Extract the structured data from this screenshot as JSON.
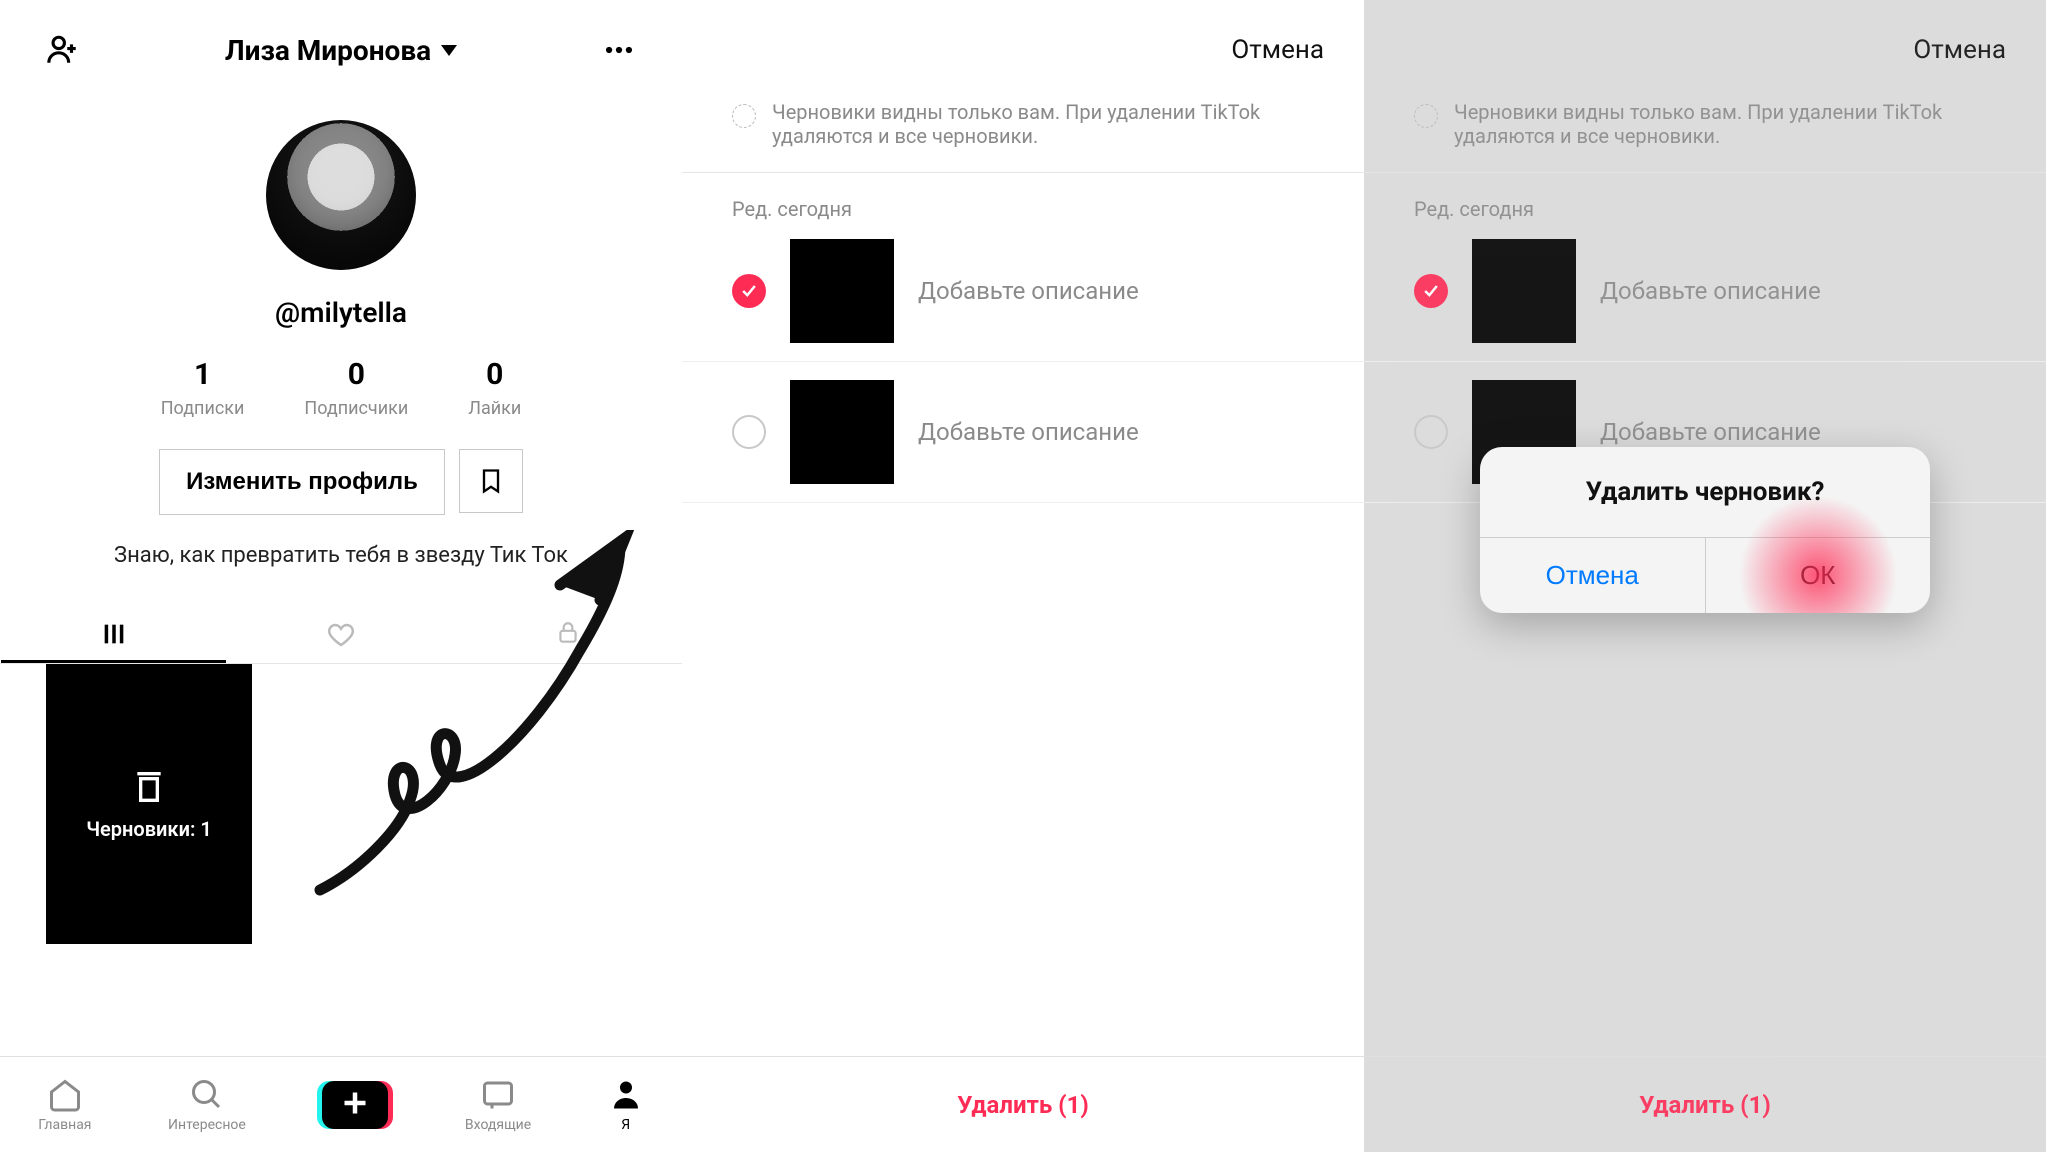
{
  "profile": {
    "display_name": "Лиза Миронова",
    "handle": "@milytella",
    "bio": "Знаю, как превратить тебя в звезду Тик Ток",
    "stats": {
      "subscriptions": {
        "n": "1",
        "label": "Подписки"
      },
      "followers": {
        "n": "0",
        "label": "Подписчики"
      },
      "likes": {
        "n": "0",
        "label": "Лайки"
      }
    },
    "edit_btn": "Изменить профиль",
    "draft_tile": "Черновики: 1"
  },
  "nav": {
    "home": "Главная",
    "discover": "Интересное",
    "inbox": "Входящие",
    "me": "Я"
  },
  "drafts": {
    "cancel": "Отмена",
    "notice": "Черновики видны только вам. При удалении TikTok удаляются и все черновики.",
    "section": "Ред. сегодня",
    "items": [
      {
        "desc": "Добавьте описание",
        "selected": true
      },
      {
        "desc": "Добавьте описание",
        "selected": false
      }
    ],
    "delete": "Удалить (1)"
  },
  "dialog": {
    "title": "Удалить черновик?",
    "cancel": "Отмена",
    "ok": "ОК"
  }
}
